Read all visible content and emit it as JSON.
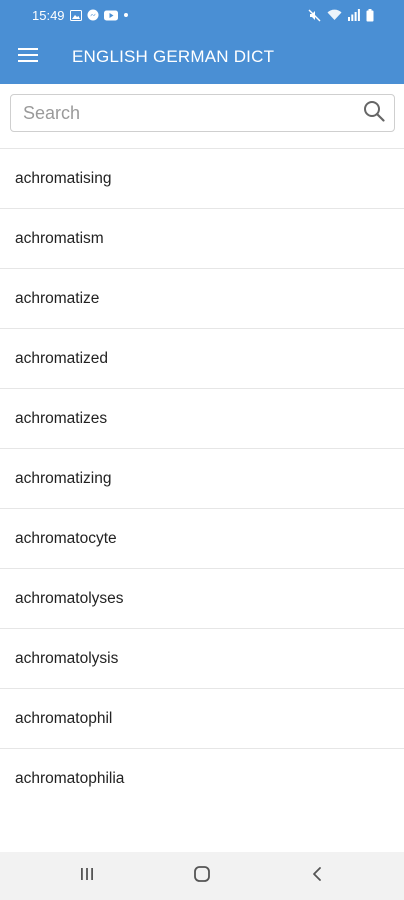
{
  "status_bar": {
    "time": "15:49",
    "left_icons": [
      "gallery-icon",
      "messenger-icon",
      "youtube-icon",
      "dot-icon"
    ],
    "right_icons": [
      "mute-icon",
      "wifi-icon",
      "signal-icon",
      "battery-icon"
    ]
  },
  "app_bar": {
    "title": "ENGLISH GERMAN DICT",
    "menu_icon": "hamburger-menu-icon",
    "color": "#4a8fd4"
  },
  "search": {
    "placeholder": "Search",
    "value": "",
    "icon": "search-icon"
  },
  "word_list": [
    "achromatising",
    "achromatism",
    "achromatize",
    "achromatized",
    "achromatizes",
    "achromatizing",
    "achromatocyte",
    "achromatolyses",
    "achromatolysis",
    "achromatophil",
    "achromatophilia"
  ],
  "nav_bar": {
    "buttons": [
      "recent-apps-icon",
      "home-icon",
      "back-icon"
    ]
  }
}
